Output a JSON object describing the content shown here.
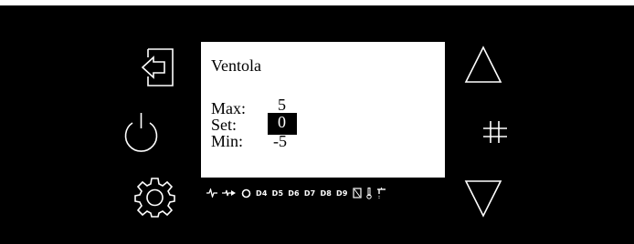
{
  "display": {
    "title": "Ventola",
    "rows": [
      {
        "label": "Max:",
        "value": "5"
      },
      {
        "label": "Set:",
        "value": "0"
      },
      {
        "label": "Min:",
        "value": "-5"
      }
    ]
  },
  "status_indicators": [
    "D4",
    "D5",
    "D6",
    "D7",
    "D8",
    "D9"
  ],
  "buttons": {
    "left": [
      "exit-icon",
      "power-icon",
      "settings-gear-icon"
    ],
    "right": [
      "up-arrow-icon",
      "hash-icon",
      "down-arrow-icon"
    ]
  },
  "colors": {
    "background": "#000000",
    "foreground": "#ffffff",
    "screen": "#ffffff"
  }
}
